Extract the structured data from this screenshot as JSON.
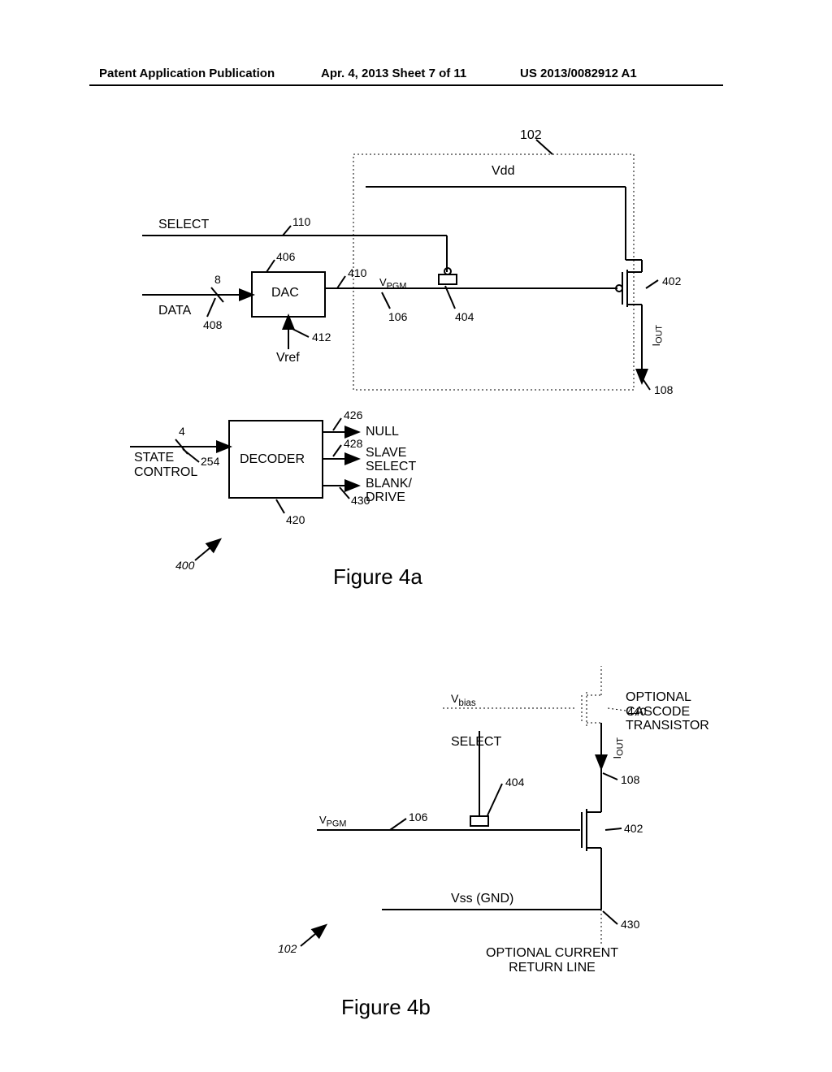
{
  "header": {
    "left": "Patent Application Publication",
    "mid": "Apr. 4, 2013  Sheet 7 of 11",
    "right": "US 2013/0082912 A1"
  },
  "fig4a": {
    "caption": "Figure 4a",
    "signals": {
      "select": "SELECT",
      "data": "DATA",
      "state_control": "STATE\nCONTROL",
      "vref": "Vref",
      "vdd": "Vdd",
      "vpgm": "VPGM",
      "iout": "IOUT"
    },
    "blocks": {
      "dac": "DAC",
      "decoder": "DECODER"
    },
    "outputs": {
      "null": "NULL",
      "slave_select": "SLAVE\nSELECT",
      "blank_drive": "BLANK/\nDRIVE"
    },
    "bus_widths": {
      "data": "8",
      "state": "4"
    },
    "refs": {
      "r102": "102",
      "r110": "110",
      "r406": "406",
      "r410": "410",
      "r106": "106",
      "r404": "404",
      "r402": "402",
      "r408": "408",
      "r412": "412",
      "r108": "108",
      "r426": "426",
      "r428": "428",
      "r430": "430",
      "r420": "420",
      "r254": "254",
      "r400": "400"
    }
  },
  "fig4b": {
    "caption": "Figure 4b",
    "signals": {
      "vbias": "Vbias",
      "select": "SELECT",
      "vpgm": "VPGM",
      "vss": "Vss (GND)",
      "iout": "IOUT"
    },
    "notes": {
      "cascode": "OPTIONAL\nCASCODE\nTRANSISTOR",
      "return": "OPTIONAL CURRENT\nRETURN LINE"
    },
    "refs": {
      "r440": "440",
      "r108": "108",
      "r404": "404",
      "r106": "106",
      "r402": "402",
      "r430": "430",
      "r102": "102"
    }
  }
}
